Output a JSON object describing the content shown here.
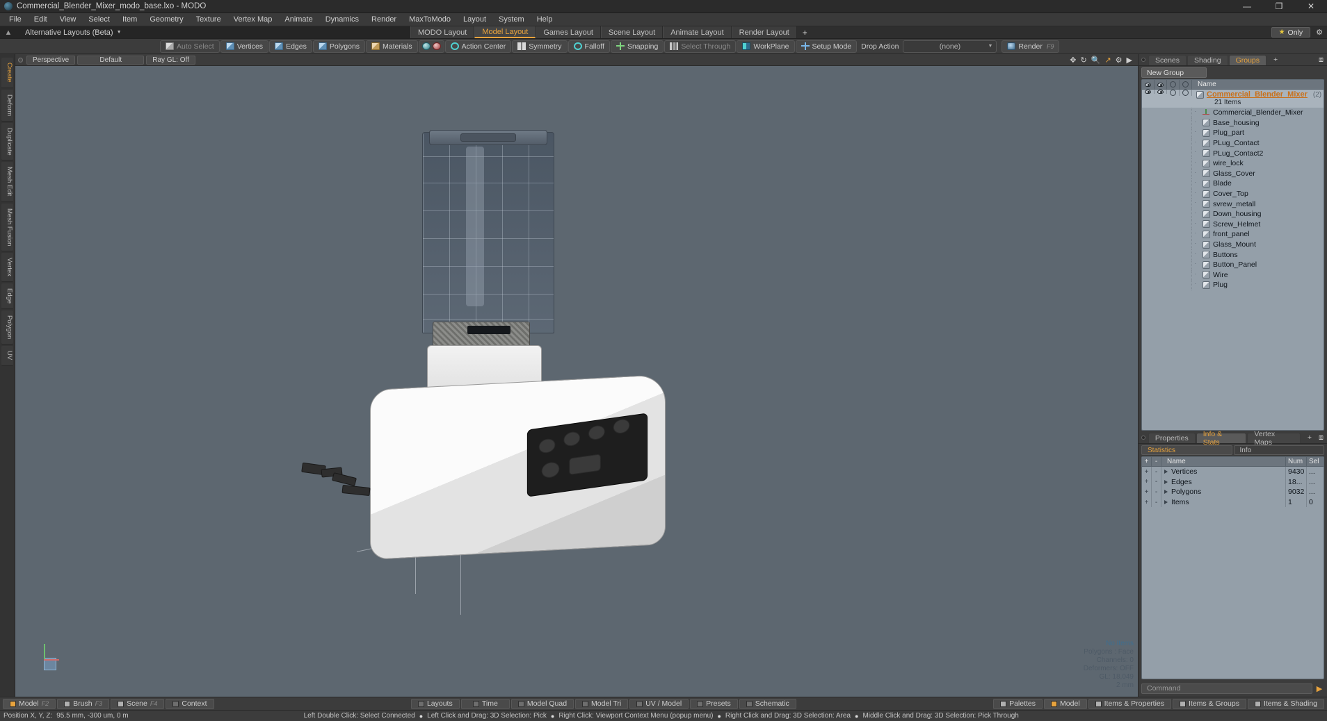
{
  "titlebar": {
    "title": "Commercial_Blender_Mixer_modo_base.lxo - MODO",
    "minimize": "—",
    "maximize": "❐",
    "close": "✕"
  },
  "menubar": {
    "items": [
      "File",
      "Edit",
      "View",
      "Select",
      "Item",
      "Geometry",
      "Texture",
      "Vertex Map",
      "Animate",
      "Dynamics",
      "Render",
      "MaxToModo",
      "Layout",
      "System",
      "Help"
    ]
  },
  "layoutrow": {
    "alt_layouts_label": "Alternative Layouts (Beta)",
    "tabs": [
      {
        "label": "MODO Layout",
        "active": false
      },
      {
        "label": "Model Layout",
        "active": true
      },
      {
        "label": "Games Layout",
        "active": false
      },
      {
        "label": "Scene Layout",
        "active": false
      },
      {
        "label": "Animate Layout",
        "active": false
      },
      {
        "label": "Render Layout",
        "active": false
      }
    ],
    "add_tab": "+",
    "only_label": "Only",
    "accent": "#e8a33d"
  },
  "toolbar": {
    "auto_select": "Auto Select",
    "vertices": "Vertices",
    "edges": "Edges",
    "polygons": "Polygons",
    "materials": "Materials",
    "action_center": "Action Center",
    "symmetry": "Symmetry",
    "falloff": "Falloff",
    "snapping": "Snapping",
    "select_through": "Select Through",
    "workplane": "WorkPlane",
    "setup_mode": "Setup Mode",
    "drop_action_label": "Drop Action",
    "drop_action_value": "(none)",
    "render": "Render",
    "render_key": "F9"
  },
  "leftstrip": {
    "tabs": [
      "Create",
      "Deform",
      "Duplicate",
      "Mesh Edit",
      "Mesh Fusion",
      "Vertex",
      "Edge",
      "Polygon",
      "UV"
    ]
  },
  "viewport": {
    "perspective": "Perspective",
    "default": "Default",
    "raygl": "Ray GL: Off",
    "stats": {
      "no_items": "No Items",
      "polygons": "Polygons : Face",
      "channels": "Channels: 0",
      "deformers": "Deformers: OFF",
      "gl": "GL: 18,049",
      "scale": "2 mm"
    }
  },
  "right_panel": {
    "tabs": [
      {
        "label": "Scenes",
        "active": false
      },
      {
        "label": "Shading",
        "active": false
      },
      {
        "label": "Groups",
        "active": true
      },
      {
        "label": "+",
        "active": false
      }
    ],
    "new_group_button": "New Group",
    "list_header_name": "Name",
    "group": {
      "name": "Commercial_Blender_Mixer",
      "count": "(2)",
      "items_label": "21 Items"
    },
    "items": [
      {
        "name": "Commercial_Blender_Mixer",
        "icon": "locator-icon"
      },
      {
        "name": "Base_housing",
        "icon": "mesh-icon"
      },
      {
        "name": "Plug_part",
        "icon": "mesh-icon"
      },
      {
        "name": "PLug_Contact",
        "icon": "mesh-icon"
      },
      {
        "name": "PLug_Contact2",
        "icon": "mesh-icon"
      },
      {
        "name": "wire_lock",
        "icon": "mesh-icon"
      },
      {
        "name": "Glass_Cover",
        "icon": "mesh-icon"
      },
      {
        "name": "Blade",
        "icon": "mesh-icon"
      },
      {
        "name": "Cover_Top",
        "icon": "mesh-icon"
      },
      {
        "name": "svrew_metall",
        "icon": "mesh-icon"
      },
      {
        "name": "Down_housing",
        "icon": "mesh-icon"
      },
      {
        "name": "Screw_Helmet",
        "icon": "mesh-icon"
      },
      {
        "name": "front_panel",
        "icon": "mesh-icon"
      },
      {
        "name": "Glass_Mount",
        "icon": "mesh-icon"
      },
      {
        "name": "Buttons",
        "icon": "mesh-icon"
      },
      {
        "name": "Button_Panel",
        "icon": "mesh-icon"
      },
      {
        "name": "Wire",
        "icon": "mesh-icon"
      },
      {
        "name": "Plug",
        "icon": "mesh-icon"
      }
    ]
  },
  "stats_panel": {
    "tabs": [
      {
        "label": "Properties",
        "active": false
      },
      {
        "label": "Info & Stats",
        "active": true
      },
      {
        "label": "Vertex Maps",
        "active": false
      },
      {
        "label": "+",
        "active": false
      }
    ],
    "statistics_button": "Statistics",
    "info_button": "Info",
    "columns": {
      "plus": "+",
      "minus": "-",
      "name": "Name",
      "num": "Num",
      "sel": "Sel"
    },
    "rows": [
      {
        "name": "Vertices",
        "num": "9430",
        "sel": "..."
      },
      {
        "name": "Edges",
        "num": "18...",
        "sel": "..."
      },
      {
        "name": "Polygons",
        "num": "9032",
        "sel": "..."
      },
      {
        "name": "Items",
        "num": "1",
        "sel": "0"
      }
    ],
    "command_placeholder": "Command"
  },
  "bottombar": {
    "left": [
      {
        "label": "Model",
        "key": "F2",
        "swatch": "or"
      },
      {
        "label": "Brush",
        "key": "F3",
        "swatch": "gy"
      },
      {
        "label": "Scene",
        "key": "F4",
        "swatch": "gy"
      },
      {
        "label": "Context",
        "key": "",
        "swatch": "dk"
      }
    ],
    "center": [
      {
        "label": "Layouts"
      },
      {
        "label": "Time"
      },
      {
        "label": "Model Quad"
      },
      {
        "label": "Model Tri"
      },
      {
        "label": "UV / Model"
      },
      {
        "label": "Presets"
      },
      {
        "label": "Schematic"
      }
    ],
    "right": [
      {
        "label": "Palettes"
      },
      {
        "label": "Model"
      },
      {
        "label": "Items & Properties"
      },
      {
        "label": "Items & Groups"
      },
      {
        "label": "Items & Shading"
      }
    ]
  },
  "statusbar": {
    "position_label": "Position X, Y, Z:",
    "position_value": "95.5 mm, -300 um, 0 m",
    "hints": [
      "Left Double Click: Select Connected",
      "Left Click and Drag: 3D Selection: Pick",
      "Right Click: Viewport Context Menu (popup menu)",
      "Right Click and Drag: 3D Selection: Area",
      "Middle Click and Drag: 3D Selection: Pick Through"
    ]
  }
}
